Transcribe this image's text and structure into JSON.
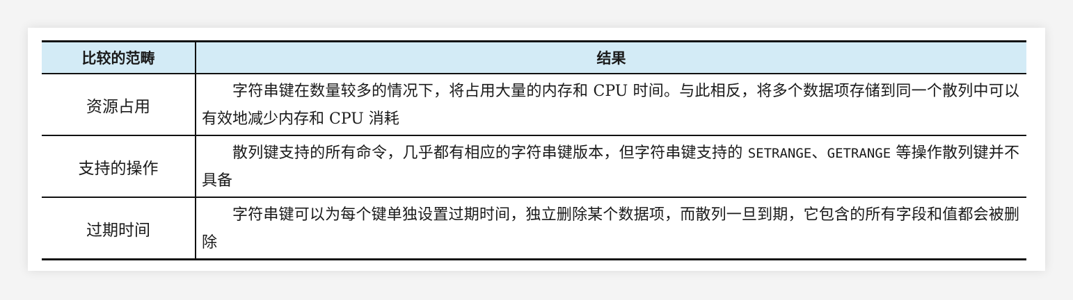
{
  "table": {
    "headers": [
      "比较的范畴",
      "结果"
    ],
    "rows": [
      {
        "category": "资源占用",
        "result": "字符串键在数量较多的情况下，将占用大量的内存和 CPU 时间。与此相反，将多个数据项存储到同一个散列中可以有效地减少内存和 CPU 消耗"
      },
      {
        "category": "支持的操作",
        "result_part1": "散列键支持的所有命令，几乎都有相应的字符串键版本，但字符串键支持的 ",
        "result_code1": "SETRANGE",
        "result_part2": "、",
        "result_code2": "GETRANGE",
        "result_part3": " 等操作散列键并不具备"
      },
      {
        "category": "过期时间",
        "result": "字符串键可以为每个键单独设置过期时间，独立删除某个数据项，而散列一旦到期，它包含的所有字段和值都会被删除"
      }
    ]
  }
}
